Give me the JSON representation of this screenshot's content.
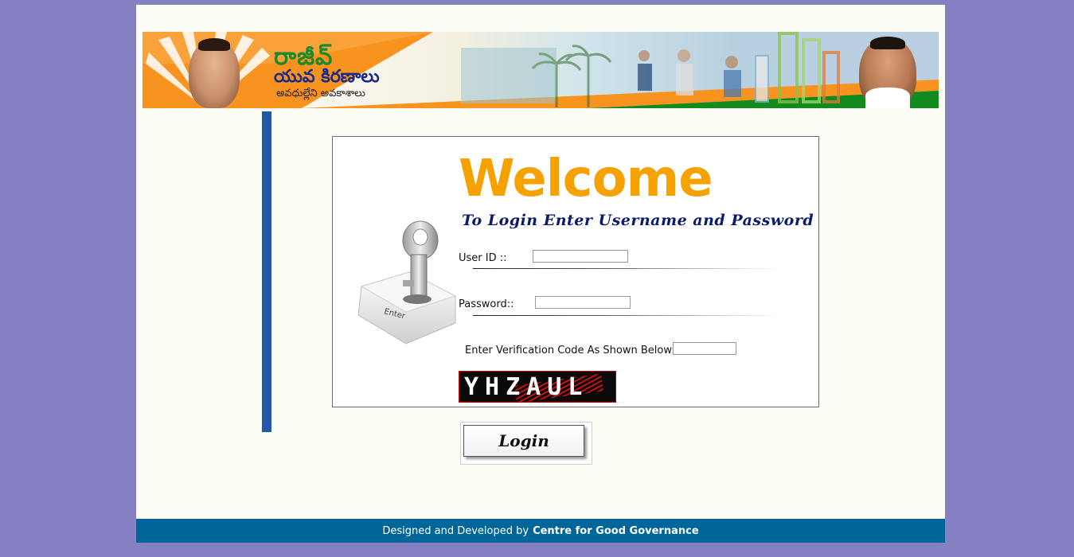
{
  "banner": {
    "title_line1": "రాజీవ్",
    "title_line2": "యువ కిరణాలు",
    "tagline": "అవధుల్లేని అవకాశాలు"
  },
  "login": {
    "welcome": "Welcome",
    "subtitle": "To Login Enter Username and Password",
    "user_id_label": "User ID ::",
    "user_id_value": "",
    "password_label": "Password::",
    "password_value": "",
    "verification_label": "Enter Verification Code As Shown Below:",
    "verification_value": "",
    "captcha_text": "YHZAUL",
    "key_label": "Enter",
    "login_button": "Login"
  },
  "footer": {
    "prefix": "Designed and Developed by",
    "org": "Centre for Good Governance"
  },
  "colors": {
    "background": "#8480c2",
    "accent_orange": "#f5a200",
    "navy": "#0b1a6e",
    "footer": "#006699",
    "panel_border": "#2258a8"
  }
}
